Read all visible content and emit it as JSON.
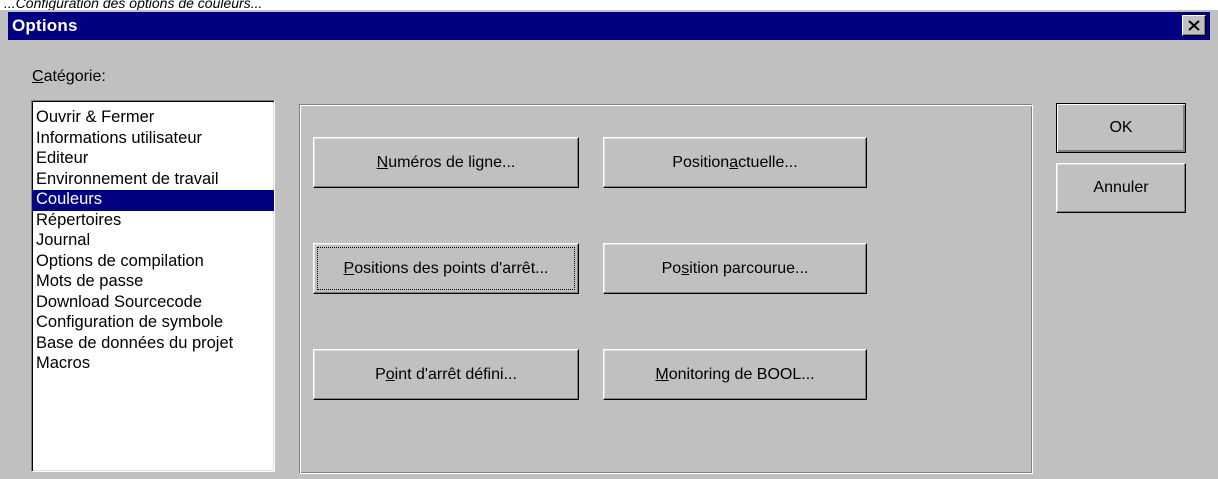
{
  "caption": "...Configuration des options de couleurs...",
  "window": {
    "title": "Options",
    "close_icon": "close-icon"
  },
  "category": {
    "label_first": "C",
    "label_rest": "atégorie:",
    "items": [
      "Ouvrir & Fermer",
      "Informations utilisateur",
      "Editeur",
      "Environnement de travail",
      "Couleurs",
      "Répertoires",
      "Journal",
      "Options de compilation",
      "Mots de passe",
      "Download Sourcecode",
      "Configuration de symbole",
      "Base de données du projet",
      "Macros"
    ],
    "selected": "Couleurs"
  },
  "colors": {
    "line_numbers": {
      "pre": "",
      "key": "N",
      "post": "uméros de ligne..."
    },
    "current_position": {
      "pre": "Position ",
      "key": "a",
      "post": "ctuelle..."
    },
    "breakpoint_positions": {
      "pre": "",
      "key": "P",
      "post": "ositions des points d'arrêt..."
    },
    "executed_position": {
      "pre": "Po",
      "key": "s",
      "post": "ition parcourue..."
    },
    "breakpoint_set": {
      "pre": "P",
      "key": "o",
      "post": "int d'arrêt défini..."
    },
    "bool_monitoring": {
      "pre": "",
      "key": "M",
      "post": "onitoring de BOOL..."
    }
  },
  "buttons": {
    "ok": "OK",
    "cancel": "Annuler"
  }
}
